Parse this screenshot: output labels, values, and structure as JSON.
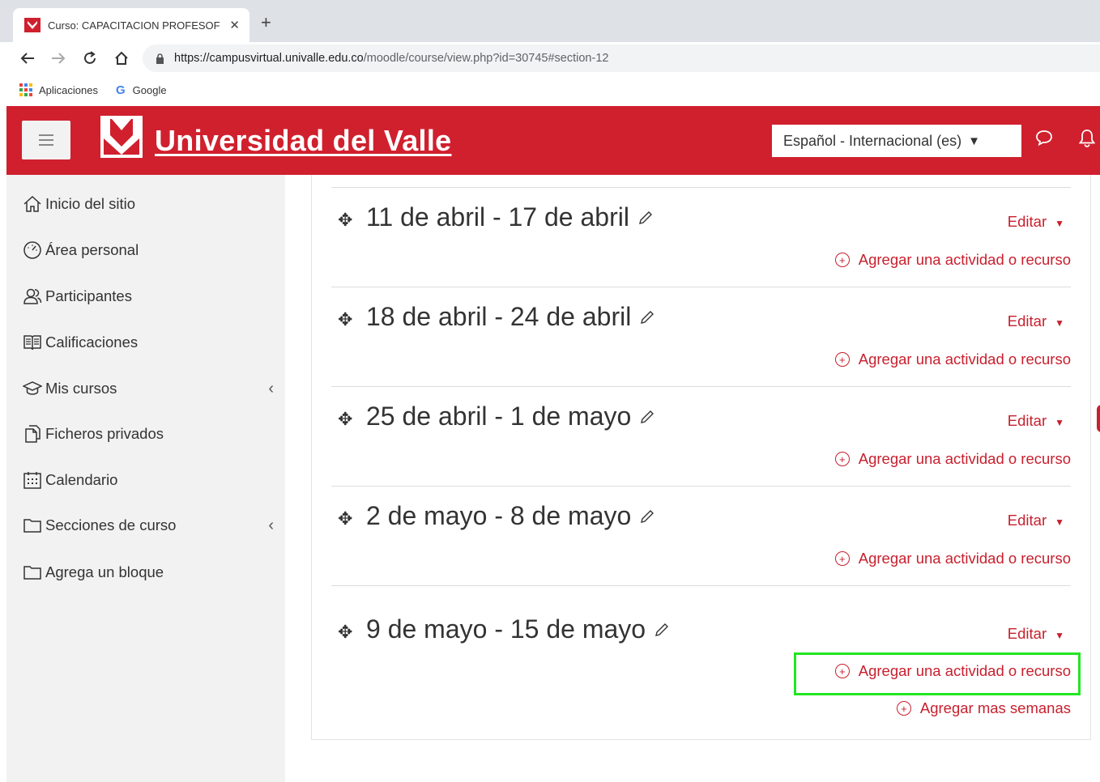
{
  "browser": {
    "tab_title": "Curso: CAPACITACION PROFESOF",
    "tab_close": "✕",
    "new_tab": "+",
    "url_host": "https://campusvirtual.univalle.edu.co",
    "url_path": "/moodle/course/view.php?id=30745#section-12",
    "bookmarks": [
      "Aplicaciones",
      "Google"
    ],
    "google_glyph": "G"
  },
  "header": {
    "brand": "Universidad del Valle",
    "language": "Español - Internacional (es)",
    "language_caret": "▼",
    "brand_color": "#d0202e"
  },
  "sidebar": {
    "items": [
      {
        "label": "Inicio del sitio",
        "icon": "home-icon"
      },
      {
        "label": "Área personal",
        "icon": "dashboard-icon"
      },
      {
        "label": "Participantes",
        "icon": "users-icon"
      },
      {
        "label": "Calificaciones",
        "icon": "grades-icon"
      },
      {
        "label": "Mis cursos",
        "icon": "graduation-cap-icon",
        "chevron": "‹"
      },
      {
        "label": "Ficheros privados",
        "icon": "files-icon"
      },
      {
        "label": "Calendario",
        "icon": "calendar-icon"
      },
      {
        "label": "Secciones de curso",
        "icon": "folder-icon",
        "chevron": "‹"
      },
      {
        "label": "Agrega un bloque",
        "icon": "folder-icon"
      }
    ]
  },
  "sections": [
    {
      "title": "11 de abril - 17 de abril",
      "edit": "Editar",
      "add": "Agregar una actividad o recurso"
    },
    {
      "title": "18 de abril - 24 de abril",
      "edit": "Editar",
      "add": "Agregar una actividad o recurso"
    },
    {
      "title": "25 de abril - 1 de mayo",
      "edit": "Editar",
      "add": "Agregar una actividad o recurso"
    },
    {
      "title": "2 de mayo - 8 de mayo",
      "edit": "Editar",
      "add": "Agregar una actividad o recurso"
    },
    {
      "title": "9 de mayo - 15 de mayo",
      "edit": "Editar",
      "add": "Agregar una actividad o recurso"
    }
  ],
  "add_weeks": "Agregar mas semanas",
  "glyphs": {
    "move": "✥",
    "plus": "+",
    "edit_caret": "▼"
  },
  "accent_color": "#c8202e",
  "highlight_color": "#22e622"
}
